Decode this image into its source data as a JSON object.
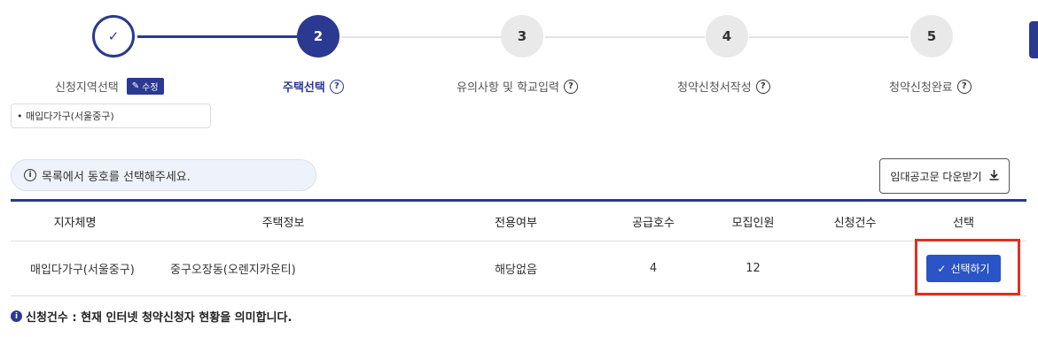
{
  "stepper": {
    "steps": [
      {
        "number": "✓",
        "label": "신청지역선택",
        "state": "done"
      },
      {
        "number": "2",
        "label": "주택선택",
        "state": "active"
      },
      {
        "number": "3",
        "label": "유의사항 및 학교입력",
        "state": "todo"
      },
      {
        "number": "4",
        "label": "청약신청서작성",
        "state": "todo"
      },
      {
        "number": "5",
        "label": "청약신청완료",
        "state": "todo"
      }
    ],
    "edit_label": "수정",
    "help_glyph": "?",
    "selected_region": "• 매입다가구(서울중구)"
  },
  "notice": {
    "icon_glyph": "i",
    "text": "목록에서 동호를 선택해주세요."
  },
  "download": {
    "label": "임대공고문 다운받기",
    "icon": "download-icon"
  },
  "table": {
    "headers": [
      "지자체명",
      "주택정보",
      "전용여부",
      "공급호수",
      "모집인원",
      "신청건수",
      "선택"
    ],
    "rows": [
      {
        "region": "매입다가구(서울중구)",
        "housing": "중구오장동(오렌지카운티)",
        "exclusive": "해당없음",
        "supply": "4",
        "recruit": "12",
        "applications": "",
        "select_label": "선택하기"
      }
    ]
  },
  "footnote": {
    "text": "신청건수 : 현재 인터넷 청약신청자 현황을 의미합니다."
  },
  "colors": {
    "primary": "#2b3990",
    "button": "#2b54c6",
    "highlight": "#e03020"
  }
}
